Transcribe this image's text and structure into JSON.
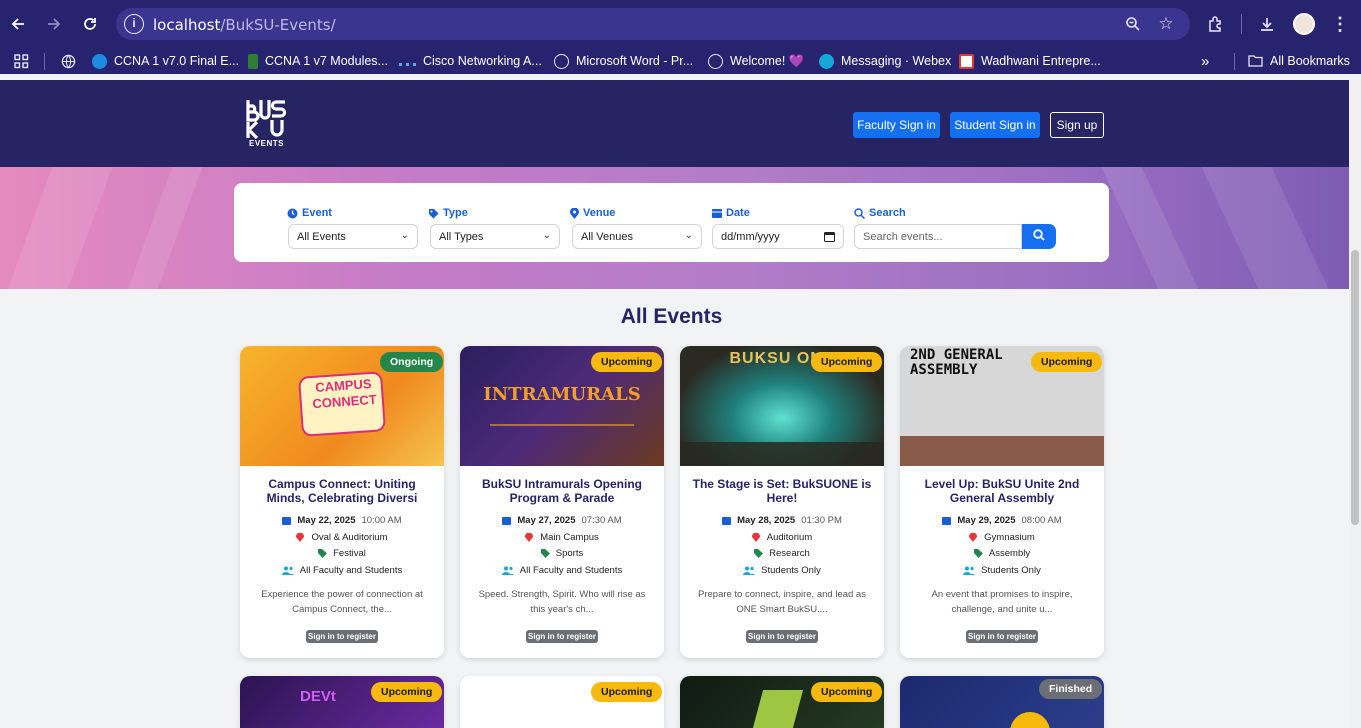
{
  "browser": {
    "url_host": "localhost",
    "url_path": "/BukSU-Events/",
    "bookmarks": [
      {
        "label": "CCNA 1 v7.0 Final E...",
        "icon": "bookmark-ccna-icon",
        "color": "#1d8ce0"
      },
      {
        "label": "CCNA 1 v7 Modules...",
        "icon": "bookmark-green-icon",
        "color": "#2e7d32"
      },
      {
        "label": "Cisco Networking A...",
        "icon": "cisco-icon",
        "color": "#5fa8e8"
      },
      {
        "label": "Microsoft Word - Pr...",
        "icon": "globe-icon",
        "color": "#e6e6f3"
      },
      {
        "label": "Welcome! 💜",
        "icon": "globe-icon",
        "color": "#e6e6f3"
      },
      {
        "label": "Messaging · Webex",
        "icon": "webex-icon",
        "color": "#16a6d8"
      },
      {
        "label": "Wadhwani Entrepre...",
        "icon": "wadhwani-icon",
        "color": "#e53935"
      }
    ],
    "more_label": "»",
    "all_bookmarks_label": "All Bookmarks"
  },
  "header": {
    "logo_text": "BuKSU",
    "logo_sub": "EVENTS",
    "faculty_signin": "Faculty Sign in",
    "student_signin": "Student Sign in",
    "signup": "Sign up"
  },
  "filters": {
    "event_label": "Event",
    "event_value": "All Events",
    "type_label": "Type",
    "type_value": "All Types",
    "venue_label": "Venue",
    "venue_value": "All Venues",
    "date_label": "Date",
    "date_value": "dd/mm/yyyy",
    "search_label": "Search",
    "search_placeholder": "Search events..."
  },
  "section_title": "All Events",
  "events": [
    {
      "status": "Ongoing",
      "title": "Campus Connect: Uniting Minds, Celebrating Diversi",
      "date": "May 22, 2025",
      "time": "10:00 AM",
      "venue": "Oval & Auditorium",
      "type": "Festival",
      "audience": "All Faculty and Students",
      "desc": "Experience the power of connection at Campus Connect, the...",
      "register": "Sign in to register",
      "poster_text": "CAMPUS CONNECT"
    },
    {
      "status": "Upcoming",
      "title": "BukSU Intramurals Opening Program & Parade",
      "date": "May 27, 2025",
      "time": "07:30 AM",
      "venue": "Main Campus",
      "type": "Sports",
      "audience": "All Faculty and Students",
      "desc": "Speed. Strength, Spirit.  Who will rise as this year's ch...",
      "register": "Sign in to register",
      "poster_text": "INTRAMURALS"
    },
    {
      "status": "Upcoming",
      "title": "The Stage is Set: BukSUONE is Here!",
      "date": "May 28, 2025",
      "time": "01:30 PM",
      "venue": "Auditorium",
      "type": "Research",
      "audience": "Students Only",
      "desc": "Prepare to connect, inspire, and lead as ONE Smart BukSU....",
      "register": "Sign in to register",
      "poster_text": "BUKSU ONE"
    },
    {
      "status": "Upcoming",
      "title": "Level Up: BukSU Unite 2nd General Assembly",
      "date": "May 29, 2025",
      "time": "08:00 AM",
      "venue": "Gymnasium",
      "type": "Assembly",
      "audience": "Students Only",
      "desc": "An event that promises to inspire, challenge, and unite u...",
      "register": "Sign in to register",
      "poster_text": "2ND GENERAL ASSEMBLY"
    }
  ],
  "next_row": [
    {
      "status": "Upcoming",
      "poster_text": "DEVt"
    },
    {
      "status": "Upcoming"
    },
    {
      "status": "Upcoming"
    },
    {
      "status": "Finished"
    }
  ],
  "colors": {
    "brand_navy": "#262463",
    "accent_blue": "#1470f0",
    "upcoming": "#f6b90c",
    "ongoing": "#24864a",
    "finished": "#6b6f75"
  }
}
